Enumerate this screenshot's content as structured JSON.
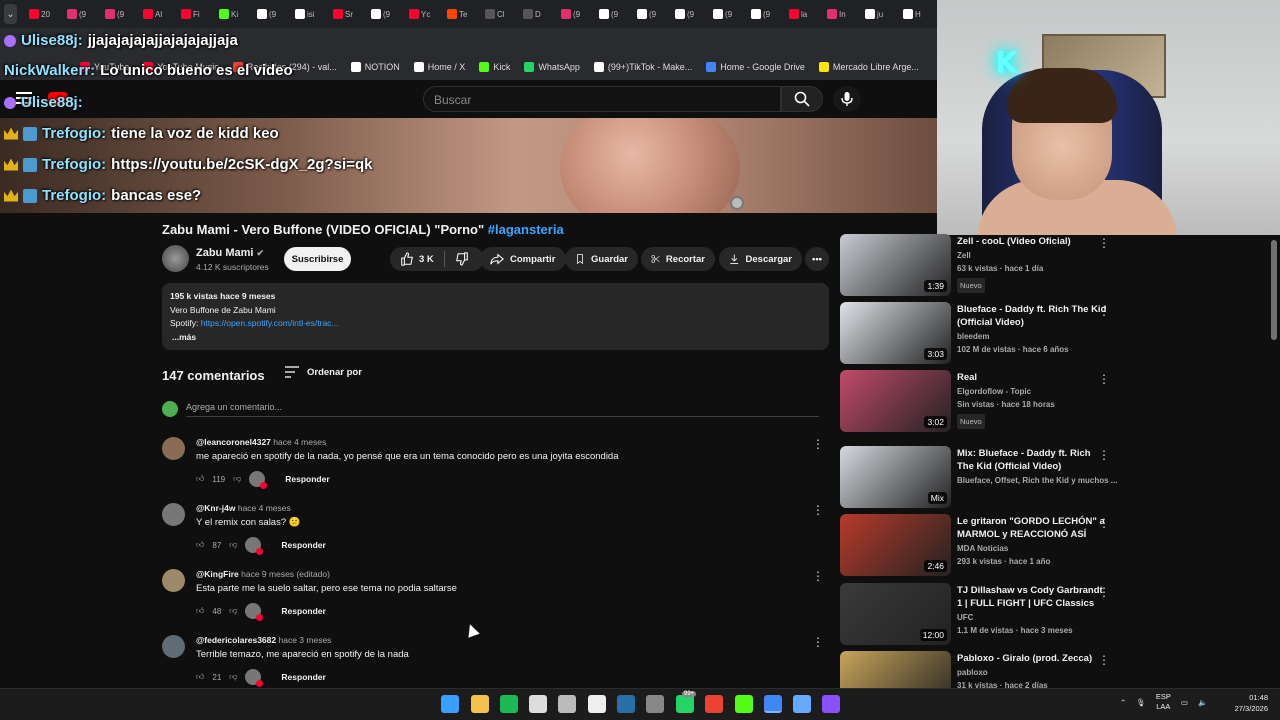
{
  "browser": {
    "tabs": [
      {
        "label": "20",
        "color": "#ff0033"
      },
      {
        "label": "(9",
        "color": "#e1306c"
      },
      {
        "label": "(9",
        "color": "#e1306c"
      },
      {
        "label": "Al",
        "color": "#ff0033"
      },
      {
        "label": "Fi",
        "color": "#ff0033"
      },
      {
        "label": "Ki",
        "color": "#53fc18"
      },
      {
        "label": "(9",
        "color": "#ffffff"
      },
      {
        "label": "isi",
        "color": "#ffffff"
      },
      {
        "label": "Sr",
        "color": "#ff0033"
      },
      {
        "label": "(9",
        "color": "#ffffff"
      },
      {
        "label": "Yc",
        "color": "#ff0033"
      },
      {
        "label": "Te",
        "color": "#ff4500"
      },
      {
        "label": "Cl",
        "color": "#555555"
      },
      {
        "label": "D",
        "color": "#555555"
      },
      {
        "label": "(9",
        "color": "#e1306c"
      },
      {
        "label": "(9",
        "color": "#ffffff"
      },
      {
        "label": "(9",
        "color": "#ffffff"
      },
      {
        "label": "(9",
        "color": "#ffffff"
      },
      {
        "label": "(9",
        "color": "#ffffff"
      },
      {
        "label": "(9",
        "color": "#ffffff"
      },
      {
        "label": "la",
        "color": "#ff0033"
      },
      {
        "label": "In",
        "color": "#e1306c"
      },
      {
        "label": "ju",
        "color": "#ffffff"
      },
      {
        "label": "H",
        "color": "#ffffff"
      }
    ],
    "bookmarks": [
      {
        "label": "YouTube",
        "color": "#ff0033"
      },
      {
        "label": "YouTube Music",
        "color": "#ff0033"
      },
      {
        "label": "Recibidos (294) - val...",
        "color": "#ea4335"
      },
      {
        "label": "NOTION",
        "color": "#ffffff"
      },
      {
        "label": "Home / X",
        "color": "#ffffff"
      },
      {
        "label": "Kick",
        "color": "#53fc18"
      },
      {
        "label": "WhatsApp",
        "color": "#25d366"
      },
      {
        "label": "(99+)TikTok - Make...",
        "color": "#ffffff"
      },
      {
        "label": "Home - Google Drive",
        "color": "#4285f4"
      },
      {
        "label": "Mercado Libre Arge...",
        "color": "#ffe600"
      }
    ]
  },
  "youtube": {
    "search_placeholder": "Buscar",
    "video": {
      "title": "Zabu Mami - Vero Buffone (VIDEO OFICIAL) \"Porno\"",
      "hashtag": "#lagansteria",
      "channel": "Zabu Mami",
      "subscribers": "4.12 K suscriptores",
      "subscribe_label": "Suscribirse",
      "likes": "3 K",
      "share_label": "Compartir",
      "save_label": "Guardar",
      "clip_label": "Recortar",
      "download_label": "Descargar"
    },
    "description": {
      "stats": "195 k vistas  hace 9 meses",
      "line1": "Vero Buffone de Zabu Mami",
      "spotify_prefix": "Spotify: ",
      "spotify_link": "https://open.spotify.com/intl-es/trac...",
      "more": "...más"
    },
    "comments": {
      "count": "147 comentarios",
      "sort_label": "Ordenar por",
      "add_placeholder": "Agrega un comentario...",
      "reply_label": "Responder",
      "items": [
        {
          "user": "@leancoronel4327",
          "time": "hace 4 meses",
          "text": "me apareció en spotify de la nada, yo pensé que era un tema conocido pero es una joyita escondida",
          "likes": "119",
          "avatar": "#8a6b55"
        },
        {
          "user": "@Knr-j4w",
          "time": "hace 4 meses",
          "text": "Y el remix con salas? 😕",
          "likes": "87",
          "avatar": "#777777"
        },
        {
          "user": "@KingFire",
          "time": "hace 9 meses (editado)",
          "text": "Esta parte me la suelo saltar, pero ese tema no podia saltarse",
          "likes": "48",
          "avatar": "#9c8a6a"
        },
        {
          "user": "@federicolares3682",
          "time": "hace 3 meses",
          "text": "Terrible temazo,  me apareció en spotify de la nada",
          "likes": "21",
          "avatar": "#5f6b75"
        }
      ]
    },
    "related": [
      {
        "title": "Zell - cooL (Video Oficial)",
        "channel": "Zell",
        "meta": "63 k vistas · hace 1 día",
        "badge": "Nuevo",
        "duration": "1:39",
        "thumb": "#c8ccd2"
      },
      {
        "title": "Blueface - Daddy ft. Rich The Kid (Official Video)",
        "channel": "bleedem",
        "meta": "102 M de vistas · hace 6 años",
        "badge": "",
        "duration": "3:03",
        "thumb": "#dfe3e8"
      },
      {
        "title": "Real",
        "channel": "Elgordoflow - Topic",
        "meta": "Sin vistas · hace 18 horas",
        "badge": "Nuevo",
        "duration": "3:02",
        "thumb": "#c24a6a"
      },
      {
        "title": "Mix: Blueface - Daddy ft. Rich The Kid (Official Video)",
        "channel": "Blueface, Offset, Rich the Kid y muchos ...",
        "meta": "",
        "badge": "",
        "duration": "Mix",
        "thumb": "#d5d9de"
      },
      {
        "title": "Le gritaron \"GORDO LECHÓN\" a MARMOL y REACCIONÓ ASÍ",
        "channel": "MDA Noticias",
        "meta": "293 k vistas · hace 1 año",
        "badge": "",
        "duration": "2:46",
        "thumb": "#b83a2a"
      },
      {
        "title": "TJ Dillashaw vs Cody Garbrandt 1 | FULL FIGHT | UFC Classics",
        "channel": "UFC",
        "meta": "1.1 M de vistas · hace 3 meses",
        "badge": "",
        "duration": "12:00",
        "thumb": "#3a3a3a"
      },
      {
        "title": "Pabloxo - Giralo (prod. Zecca)",
        "channel": "pabloxo",
        "meta": "31 k vistas · hace 2 días",
        "badge": "",
        "duration": "",
        "thumb": "#c9a45a"
      }
    ]
  },
  "chat": [
    {
      "user": "Ulise88j",
      "sep": ": ",
      "text": "jjajajajajajjajajajajjaja",
      "badges": [
        "kick"
      ]
    },
    {
      "user": "NickWalkerr",
      "sep": ": ",
      "text": "Lo unico bueno es el video",
      "badges": []
    },
    {
      "user": "Ulise88j",
      "sep": ":",
      "text": "",
      "badges": [
        "kick"
      ]
    },
    {
      "user": "Trefogio",
      "sep": ": ",
      "text": "tiene la voz de kidd keo",
      "badges": [
        "crown",
        "sub"
      ]
    },
    {
      "user": "Trefogio",
      "sep": ": ",
      "text": "https://youtu.be/2cSK-dgX_2g?si=qk",
      "badges": [
        "crown",
        "sub"
      ]
    },
    {
      "user": "Trefogio",
      "sep": ": ",
      "text": "bancas ese?",
      "badges": [
        "crown",
        "sub"
      ]
    }
  ],
  "taskbar": {
    "icons": [
      {
        "name": "windows-start-icon",
        "color": "#3aa0ff"
      },
      {
        "name": "file-explorer-icon",
        "color": "#f2c14e"
      },
      {
        "name": "spotify-icon",
        "color": "#1db954"
      },
      {
        "name": "store-icon",
        "color": "#dddddd"
      },
      {
        "name": "app-icon",
        "color": "#bbbbbb"
      },
      {
        "name": "capcut-icon",
        "color": "#eeeeee"
      },
      {
        "name": "steam-icon",
        "color": "#2a6ea8"
      },
      {
        "name": "obs-icon",
        "color": "#888888"
      },
      {
        "name": "whatsapp-icon",
        "color": "#25d366"
      },
      {
        "name": "chrome-icon",
        "color": "#ea4335"
      },
      {
        "name": "kick-icon",
        "color": "#53fc18"
      },
      {
        "name": "chrome-active-icon",
        "color": "#4285f4"
      },
      {
        "name": "notepad-icon",
        "color": "#66aaff"
      },
      {
        "name": "app-purple-icon",
        "color": "#8a4fff"
      }
    ],
    "whatsapp_badge": "99+",
    "lang": "ESP",
    "lang_sub": "LAA",
    "time": "01:48",
    "date": "27/3/2026"
  }
}
